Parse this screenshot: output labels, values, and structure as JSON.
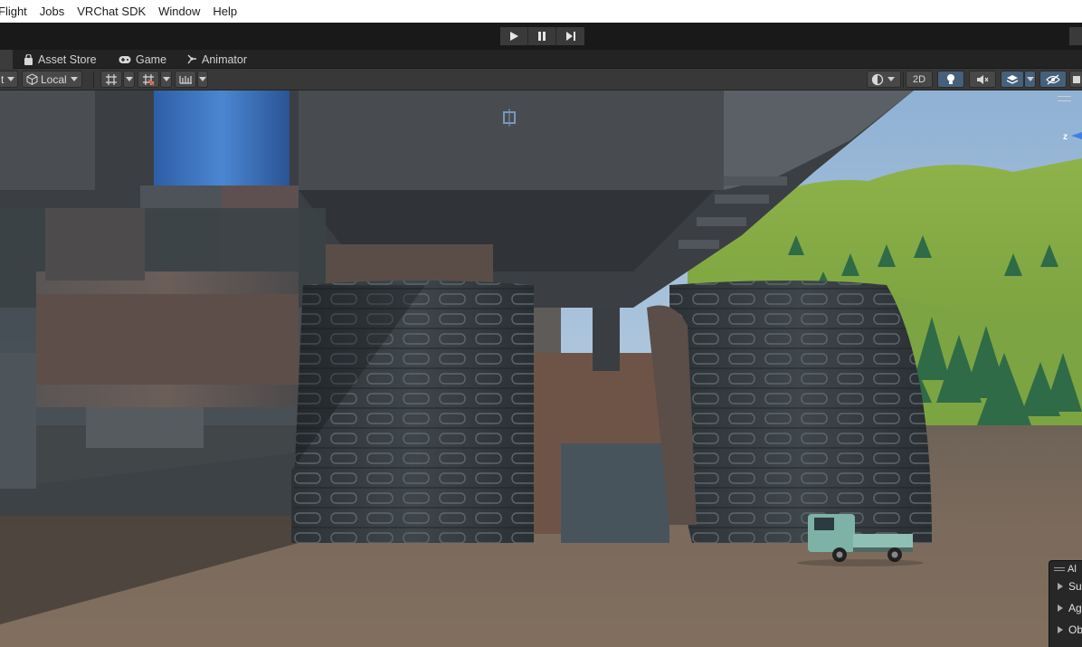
{
  "menu": [
    "Flight",
    "Jobs",
    "VRChat SDK",
    "Window",
    "Help"
  ],
  "play_controls": [
    {
      "name": "play-button",
      "icon": "play-icon"
    },
    {
      "name": "pause-button",
      "icon": "pause-icon"
    },
    {
      "name": "step-button",
      "icon": "step-icon"
    }
  ],
  "tabs": [
    {
      "label": "Asset Store",
      "icon": "shopping-bag-icon"
    },
    {
      "label": "Game",
      "icon": "gamepad-icon"
    },
    {
      "label": "Animator",
      "icon": "animator-icon"
    }
  ],
  "scene_toolbar": {
    "pivot_label": "t",
    "space_label": "Local",
    "toggle_2d": "2D"
  },
  "gizmo": {
    "axis": "z"
  },
  "overlay": {
    "header": "Al",
    "items": [
      "Su",
      "Ag",
      "Ob"
    ]
  },
  "colors": {
    "menu_bg": "#ffffff",
    "toolbar_bg": "#383838",
    "active_toggle": "#46607c",
    "sky": "#a9c4de",
    "ground": "#7a6a5c"
  }
}
